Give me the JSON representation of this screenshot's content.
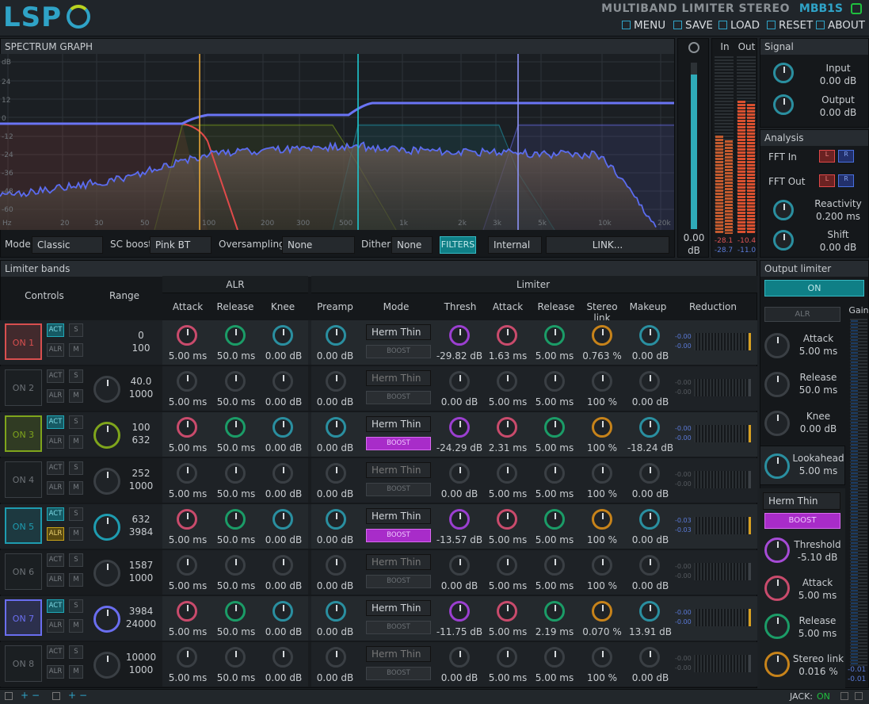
{
  "header": {
    "logo": "LSP",
    "title": "MULTIBAND LIMITER STEREO",
    "code": "MBB1S",
    "menu": "MENU",
    "save": "SAVE",
    "load": "LOAD",
    "reset": "RESET",
    "about": "ABOUT"
  },
  "spectrum": {
    "title": "SPECTRUM GRAPH",
    "ylabels": [
      "dB",
      "24",
      "12",
      "0",
      "-12",
      "-24",
      "-36",
      "-48",
      "-60"
    ],
    "xlabels": [
      "Hz",
      "20",
      "30",
      "50",
      "100",
      "200",
      "300",
      "500",
      "1k",
      "2k",
      "3k",
      "5k",
      "10k",
      "20k"
    ],
    "gain_value": "0.00",
    "gain_unit": "dB",
    "in_label": "In",
    "out_label": "Out",
    "in_vals": [
      "-28.1",
      "-28.7"
    ],
    "out_vals": [
      "-10.4",
      "-11.0"
    ]
  },
  "controls": {
    "mode_label": "Mode:",
    "mode": "Classic",
    "scboost_label": "SC boost:",
    "scboost": "Pink BT",
    "os_label": "Oversampling:",
    "os": "None",
    "dither_label": "Dither:",
    "dither": "None",
    "filters": "FILTERS",
    "source": "Internal",
    "link": "LINK..."
  },
  "signal": {
    "title": "Signal",
    "input_label": "Input",
    "input": "0.00 dB",
    "output_label": "Output",
    "output": "0.00 dB"
  },
  "analysis": {
    "title": "Analysis",
    "fft_in": "FFT In",
    "fft_out": "FFT Out",
    "l": "L",
    "r": "R",
    "reactivity_label": "Reactivity",
    "reactivity": "0.200 ms",
    "shift_label": "Shift",
    "shift": "0.00 dB"
  },
  "bands": {
    "title": "Limiter bands",
    "alr": "ALR",
    "limiter": "Limiter",
    "controls": "Controls",
    "range": "Range",
    "cols": [
      "Attack",
      "Release",
      "Knee",
      "Preamp",
      "Mode",
      "Thresh",
      "Attack",
      "Release",
      "Stereo link",
      "Makeup",
      "Reduction"
    ],
    "act": "ACT",
    "s": "S",
    "alrbtn": "ALR",
    "m": "M",
    "boost": "BOOST",
    "rows": [
      {
        "on": "ON 1",
        "range": [
          "0",
          "100"
        ],
        "alr": [
          "5.00 ms",
          "50.0 ms",
          "0.00 dB"
        ],
        "pre": "0.00 dB",
        "mode": "Herm Thin",
        "thr": "-29.82 dB",
        "att": "1.63 ms",
        "rel": "5.00 ms",
        "sl": "0.763 %",
        "mk": "0.00 dB",
        "red": [
          "-0.00",
          "-0.00"
        ],
        "color": "#d84f4f",
        "active": true,
        "boost": false
      },
      {
        "on": "ON 2",
        "range": [
          "40.0",
          "1000"
        ],
        "alr": [
          "5.00 ms",
          "50.0 ms",
          "0.00 dB"
        ],
        "pre": "0.00 dB",
        "mode": "Herm Thin",
        "thr": "0.00 dB",
        "att": "5.00 ms",
        "rel": "5.00 ms",
        "sl": "100 %",
        "mk": "0.00 dB",
        "red": [
          "-0.00",
          "-0.00"
        ],
        "color": "",
        "active": false,
        "boost": false
      },
      {
        "on": "ON 3",
        "range": [
          "100",
          "632"
        ],
        "alr": [
          "5.00 ms",
          "50.0 ms",
          "0.00 dB"
        ],
        "pre": "0.00 dB",
        "mode": "Herm Thin",
        "thr": "-24.29 dB",
        "att": "2.31 ms",
        "rel": "5.00 ms",
        "sl": "100 %",
        "mk": "-18.24 dB",
        "red": [
          "-0.00",
          "-0.00"
        ],
        "color": "#7fa51c",
        "active": true,
        "boost": true
      },
      {
        "on": "ON 4",
        "range": [
          "252",
          "1000"
        ],
        "alr": [
          "5.00 ms",
          "50.0 ms",
          "0.00 dB"
        ],
        "pre": "0.00 dB",
        "mode": "Herm Thin",
        "thr": "0.00 dB",
        "att": "5.00 ms",
        "rel": "5.00 ms",
        "sl": "100 %",
        "mk": "0.00 dB",
        "red": [
          "-0.00",
          "-0.00"
        ],
        "color": "",
        "active": false,
        "boost": false
      },
      {
        "on": "ON 5",
        "range": [
          "632",
          "3984"
        ],
        "alr": [
          "5.00 ms",
          "50.0 ms",
          "0.00 dB"
        ],
        "pre": "0.00 dB",
        "mode": "Herm Thin",
        "thr": "-13.57 dB",
        "att": "5.00 ms",
        "rel": "5.00 ms",
        "sl": "100 %",
        "mk": "0.00 dB",
        "red": [
          "-0.03",
          "-0.03"
        ],
        "color": "#1e9cb0",
        "active": true,
        "boost": true
      },
      {
        "on": "ON 6",
        "range": [
          "1587",
          "1000"
        ],
        "alr": [
          "5.00 ms",
          "50.0 ms",
          "0.00 dB"
        ],
        "pre": "0.00 dB",
        "mode": "Herm Thin",
        "thr": "0.00 dB",
        "att": "5.00 ms",
        "rel": "5.00 ms",
        "sl": "100 %",
        "mk": "0.00 dB",
        "red": [
          "-0.00",
          "-0.00"
        ],
        "color": "",
        "active": false,
        "boost": false
      },
      {
        "on": "ON 7",
        "range": [
          "3984",
          "24000"
        ],
        "alr": [
          "5.00 ms",
          "50.0 ms",
          "0.00 dB"
        ],
        "pre": "0.00 dB",
        "mode": "Herm Thin",
        "thr": "-11.75 dB",
        "att": "5.00 ms",
        "rel": "2.19 ms",
        "sl": "0.070 %",
        "mk": "13.91 dB",
        "red": [
          "-0.00",
          "-0.00"
        ],
        "color": "#6a6ef0",
        "active": true,
        "boost": false
      },
      {
        "on": "ON 8",
        "range": [
          "10000",
          "1000"
        ],
        "alr": [
          "5.00 ms",
          "50.0 ms",
          "0.00 dB"
        ],
        "pre": "0.00 dB",
        "mode": "Herm Thin",
        "thr": "0.00 dB",
        "att": "5.00 ms",
        "rel": "5.00 ms",
        "sl": "100 %",
        "mk": "0.00 dB",
        "red": [
          "-0.00",
          "-0.00"
        ],
        "color": "",
        "active": false,
        "boost": false
      }
    ]
  },
  "output_limiter": {
    "title": "Output limiter",
    "on": "ON",
    "alr": "ALR",
    "gain": "Gain",
    "attack_label": "Attack",
    "attack": "5.00 ms",
    "release_label": "Release",
    "release": "50.0 ms",
    "knee_label": "Knee",
    "knee": "0.00 dB",
    "lookahead_label": "Lookahead",
    "lookahead": "5.00 ms",
    "mode": "Herm Thin",
    "boost": "BOOST",
    "thresh_label": "Threshold",
    "thresh": "-5.10 dB",
    "att2_label": "Attack",
    "att2": "5.00 ms",
    "rel2_label": "Release",
    "rel2": "5.00 ms",
    "sl_label": "Stereo link",
    "sl": "0.016 %",
    "gain_vals": [
      "-0.01",
      "-0.01"
    ]
  },
  "footer": {
    "jack": "JACK:",
    "jack_status": "ON"
  }
}
